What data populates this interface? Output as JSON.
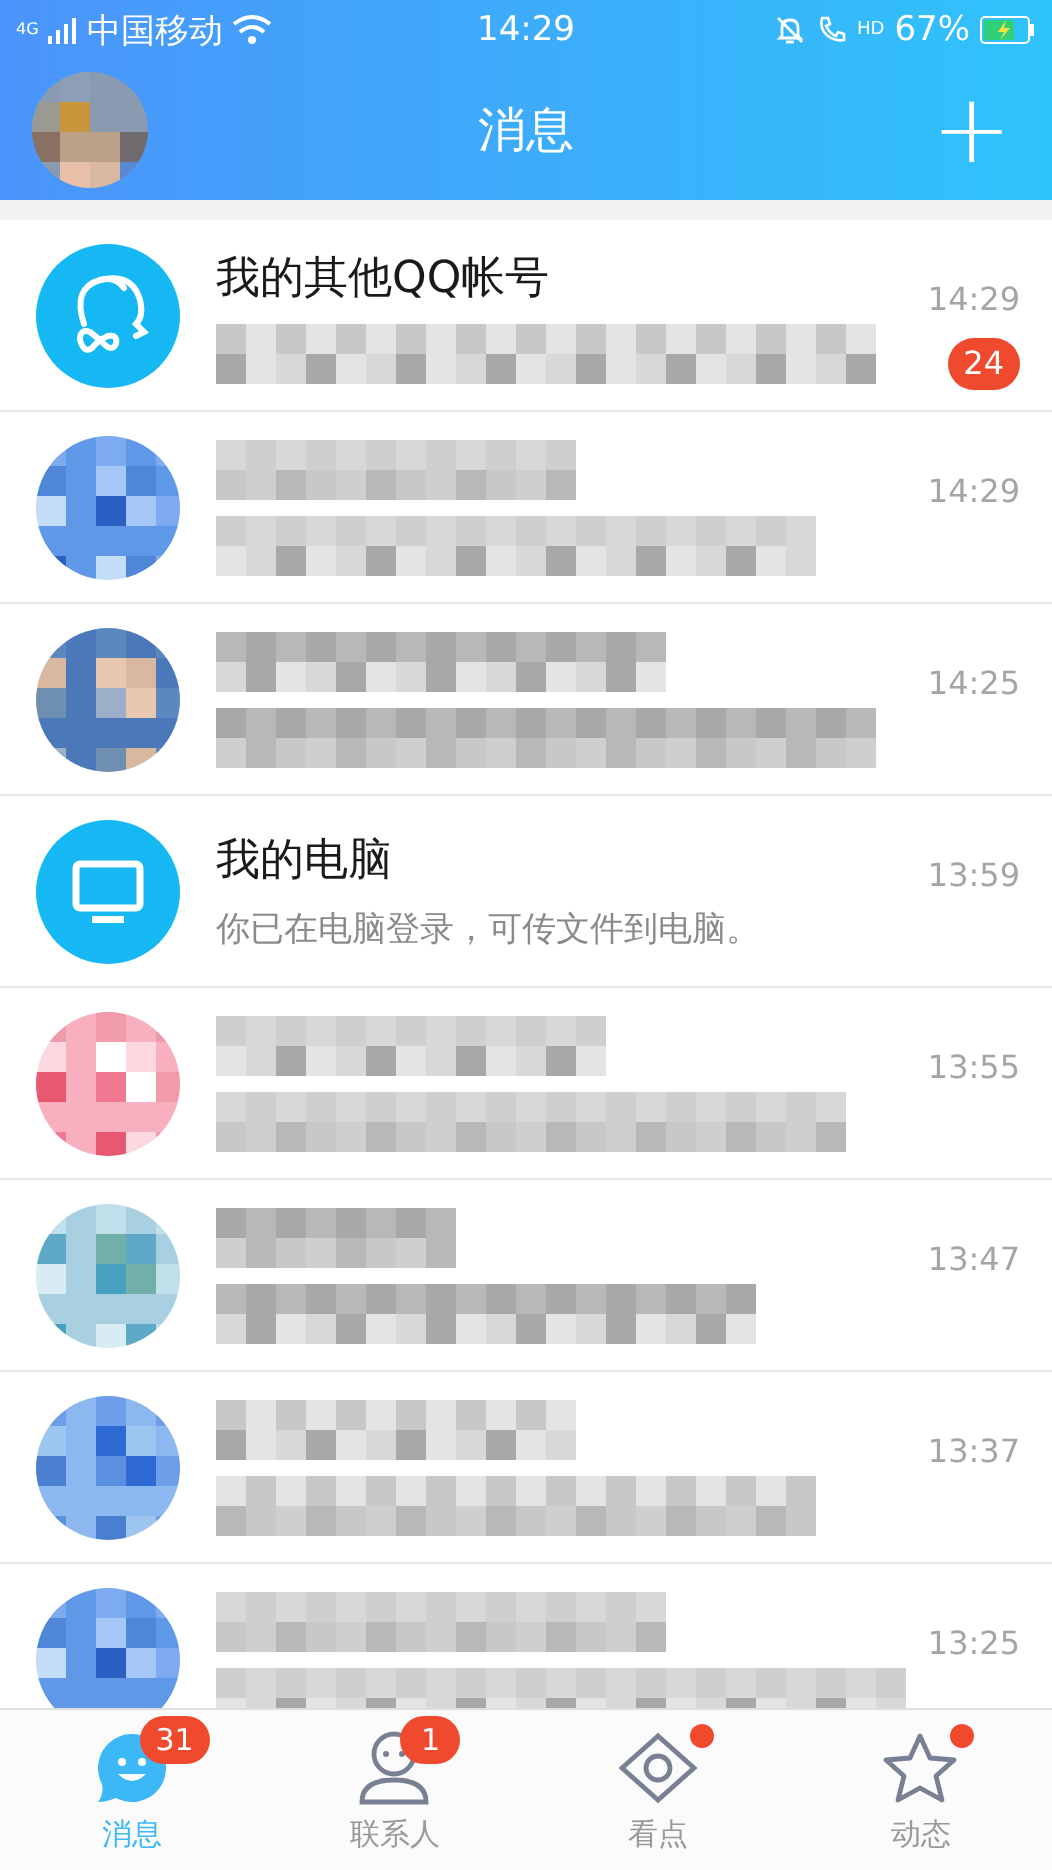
{
  "status_bar": {
    "network": "4G",
    "carrier": "中国移动",
    "time": "14:29",
    "call_label": "HD",
    "battery": "67%"
  },
  "header": {
    "title": "消息",
    "add_symbol": "+"
  },
  "conversations": [
    {
      "kind": "accounts",
      "name": "我的其他QQ帐号",
      "time": "14:29",
      "badge": "24"
    },
    {
      "kind": "blurred",
      "time": "14:29"
    },
    {
      "kind": "blurred",
      "time": "14:25"
    },
    {
      "kind": "computer",
      "name": "我的电脑",
      "preview": "你已在电脑登录，可传文件到电脑。",
      "time": "13:59"
    },
    {
      "kind": "blurred",
      "time": "13:55"
    },
    {
      "kind": "blurred",
      "time": "13:47"
    },
    {
      "kind": "blurred",
      "time": "13:37"
    },
    {
      "kind": "blurred",
      "time": "13:25"
    }
  ],
  "tabs": [
    {
      "kind": "messages",
      "label": "消息",
      "selected": true,
      "badge": "31",
      "dot": false
    },
    {
      "kind": "contacts",
      "label": "联系人",
      "selected": false,
      "badge": "1",
      "dot": false
    },
    {
      "kind": "discover",
      "label": "看点",
      "selected": false,
      "dot": true
    },
    {
      "kind": "feed",
      "label": "动态",
      "selected": false,
      "dot": true
    }
  ]
}
